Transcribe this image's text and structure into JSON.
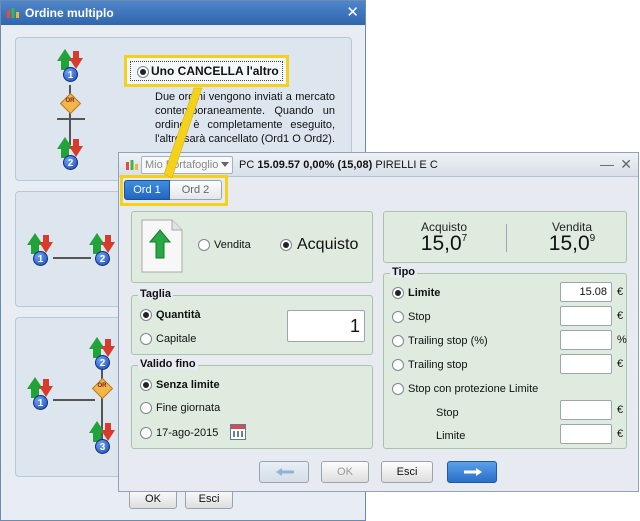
{
  "back_window": {
    "title": "Ordine multiplo",
    "close_glyph": "✕",
    "option_label": "Uno CANCELLA l'altro",
    "description": "Due ordini vengono inviati a mercato contemporaneamente. Quando un ordine è completamente eseguito, l'altro sarà cancellato (Ord1 O Ord2).",
    "or_text": "OR",
    "order_numbers": [
      "1",
      "2",
      "1",
      "2",
      "2",
      "1",
      "3"
    ],
    "ok_label": "OK",
    "esci_label": "Esci"
  },
  "front_window": {
    "portfolio": "Mio Portafoglio",
    "ticker": {
      "code": "PC",
      "time": "15.09.57",
      "change": "0,00% (15,08)",
      "name": "PIRELLI E C"
    },
    "min_glyph": "—",
    "close_glyph": "✕",
    "tabs": [
      {
        "label": "Ord 1",
        "active": true
      },
      {
        "label": "Ord 2",
        "active": false
      }
    ],
    "side": {
      "sell_label": "Vendita",
      "buy_label": "Acquisto",
      "selected": "Acquisto"
    },
    "prices": {
      "buy_label": "Acquisto",
      "buy_main": "15,0",
      "buy_sup": "7",
      "sell_label": "Vendita",
      "sell_main": "15,0",
      "sell_sup": "9"
    },
    "taglia": {
      "title": "Taglia",
      "quantity_label": "Quantità",
      "capital_label": "Capitale",
      "value": "1"
    },
    "valido": {
      "title": "Valido fino",
      "options": [
        "Senza limite",
        "Fine giornata",
        "17-ago-2015"
      ],
      "selected": "Senza limite"
    },
    "tipo": {
      "title": "Tipo",
      "rows": [
        {
          "label": "Limite",
          "value": "15.08",
          "unit": "€",
          "selected": true
        },
        {
          "label": "Stop",
          "value": "",
          "unit": "€",
          "selected": false
        },
        {
          "label": "Trailing stop (%)",
          "value": "",
          "unit": "%",
          "selected": false
        },
        {
          "label": "Trailing stop",
          "value": "",
          "unit": "€",
          "selected": false
        }
      ],
      "protection_label": "Stop con protezione Limite",
      "stop_label": "Stop",
      "limit_label": "Limite",
      "stop_unit": "€",
      "limit_unit": "€"
    },
    "footer": {
      "ok_label": "OK",
      "esci_label": "Esci"
    }
  },
  "colors": {
    "title_blue": "#2f66ae",
    "highlight_yellow": "#f4d21c",
    "panel_green": "#dfebdf",
    "next_button_blue": "#2a6fc8"
  },
  "icons": [
    "app-chart-icon",
    "order-up-down-icon",
    "or-diamond-icon",
    "document-buy-icon",
    "calendar-icon",
    "arrow-left-icon",
    "arrow-right-icon"
  ]
}
